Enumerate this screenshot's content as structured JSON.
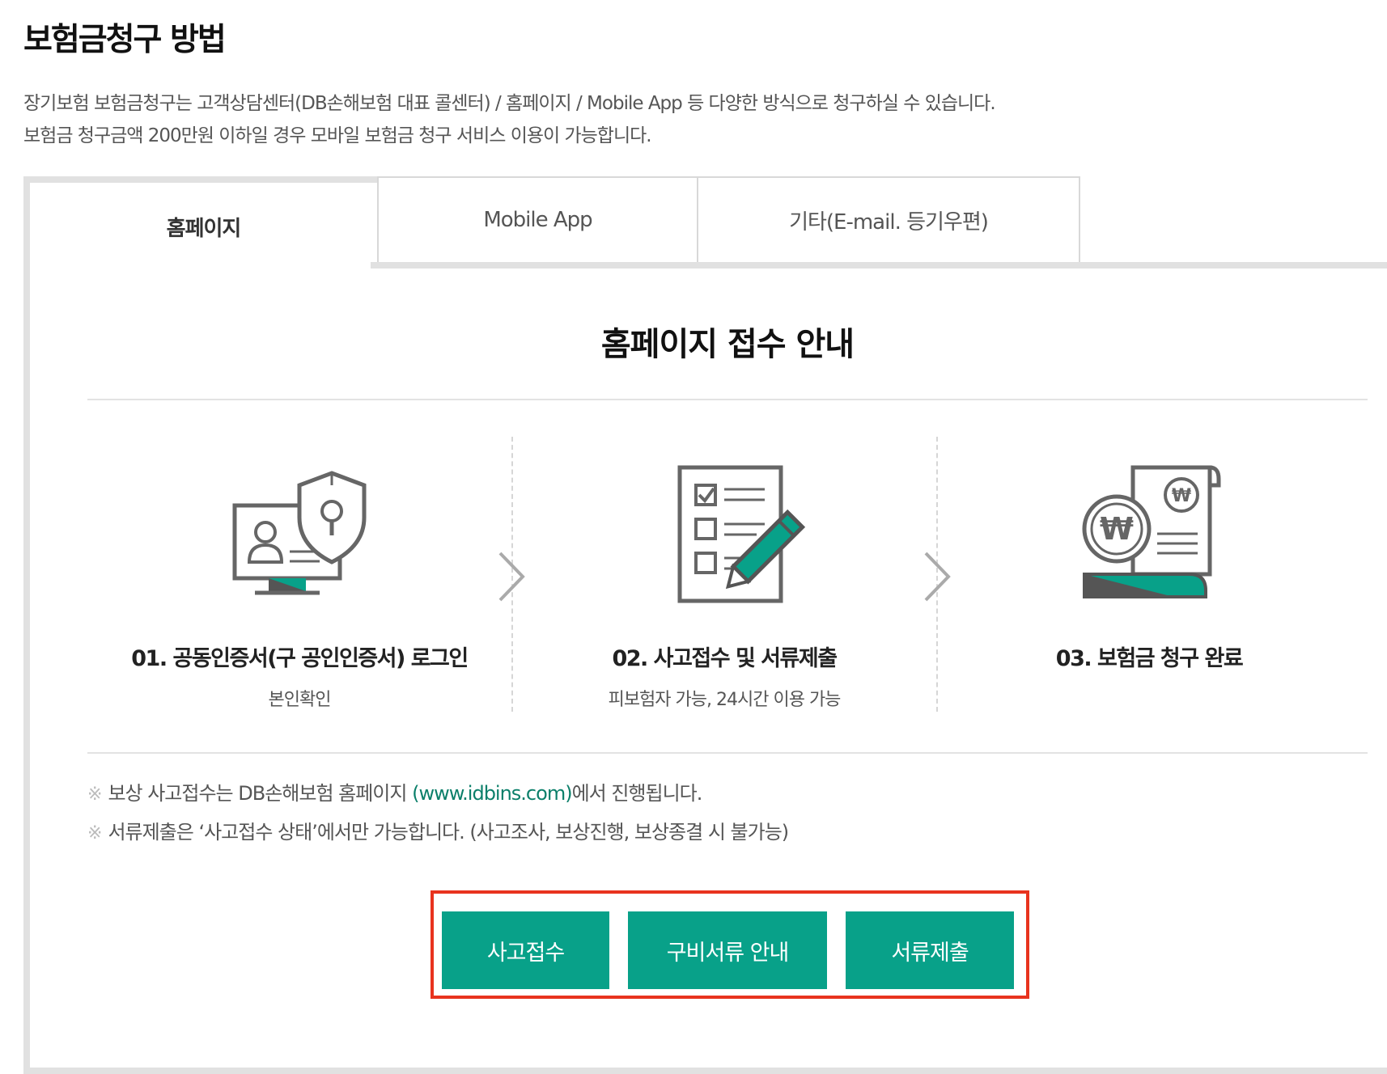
{
  "page": {
    "title": "보험금청구 방법",
    "intro": [
      "장기보험 보험금청구는 고객상담센터(DB손해보험 대표 콜센터) / 홈페이지 / Mobile App 등 다양한 방식으로 청구하실 수 있습니다.",
      "보험금 청구금액 200만원 이하일 경우 모바일 보험금 청구 서비스 이용이 가능합니다."
    ]
  },
  "tabs": [
    {
      "label": "홈페이지",
      "active": true
    },
    {
      "label": "Mobile App",
      "active": false
    },
    {
      "label": "기타(E-mail. 등기우편)",
      "active": false
    }
  ],
  "section": {
    "title": "홈페이지 접수 안내",
    "steps": [
      {
        "icon": "certificate-login-icon",
        "title": "01. 공동인증서(구 공인인증서) 로그인",
        "desc": "본인확인"
      },
      {
        "icon": "document-checklist-icon",
        "title": "02. 사고접수 및 서류제출",
        "desc": "피보험자 가능, 24시간 이용 가능"
      },
      {
        "icon": "claim-complete-icon",
        "title": "03. 보험금 청구 완료",
        "desc": ""
      }
    ],
    "notes": [
      {
        "mark": "※",
        "pre": "보상 사고접수는 DB손해보험 홈페이지 ",
        "link": "(www.idbins.com)",
        "post": "에서 진행됩니다."
      },
      {
        "mark": "※",
        "pre": "서류제출은 ‘사고접수 상태’에서만 가능합니다. (사고조사, 보상진행, 보상종결 시 불가능)",
        "link": "",
        "post": ""
      }
    ],
    "buttons": {
      "accident_report": "사고접수",
      "required_docs": "구비서류 안내",
      "submit_docs": "서류제출"
    }
  },
  "colors": {
    "accent": "#08a189",
    "highlight_frame": "#e8331e",
    "link": "#0b7f6a"
  }
}
